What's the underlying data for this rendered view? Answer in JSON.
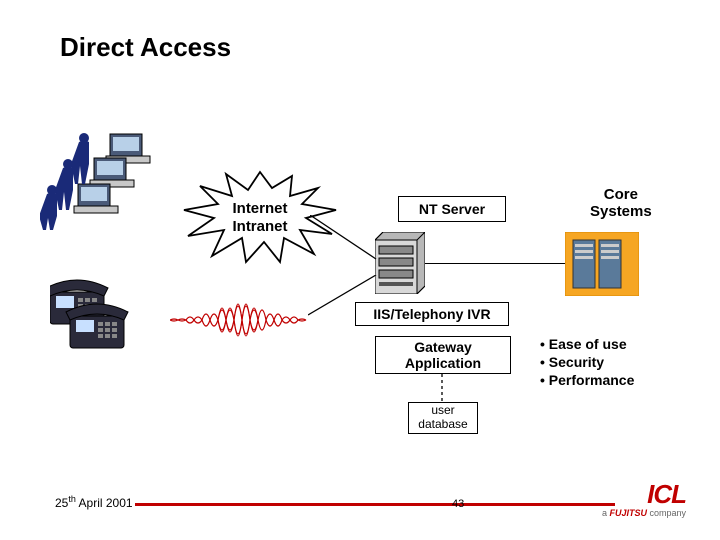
{
  "title": "Direct Access",
  "burst": {
    "line1": "Internet",
    "line2": "Intranet"
  },
  "nt_server": "NT Server",
  "core_systems": {
    "line1": "Core",
    "line2": "Systems"
  },
  "iis_ivr": "IIS/Telephony IVR",
  "gateway": {
    "line1": "Gateway",
    "line2": "Application"
  },
  "userdb": {
    "line1": "user",
    "line2": "database"
  },
  "bullets": {
    "b1": "• Ease of use",
    "b2": "• Security",
    "b3": "• Performance"
  },
  "footer": {
    "day": "25",
    "ord": "th",
    "rest": " April 2001"
  },
  "page": "43",
  "logo": {
    "brand": "ICL",
    "sub_pre": "a ",
    "sub_mark": "FUJITSU",
    "sub_post": " company"
  }
}
